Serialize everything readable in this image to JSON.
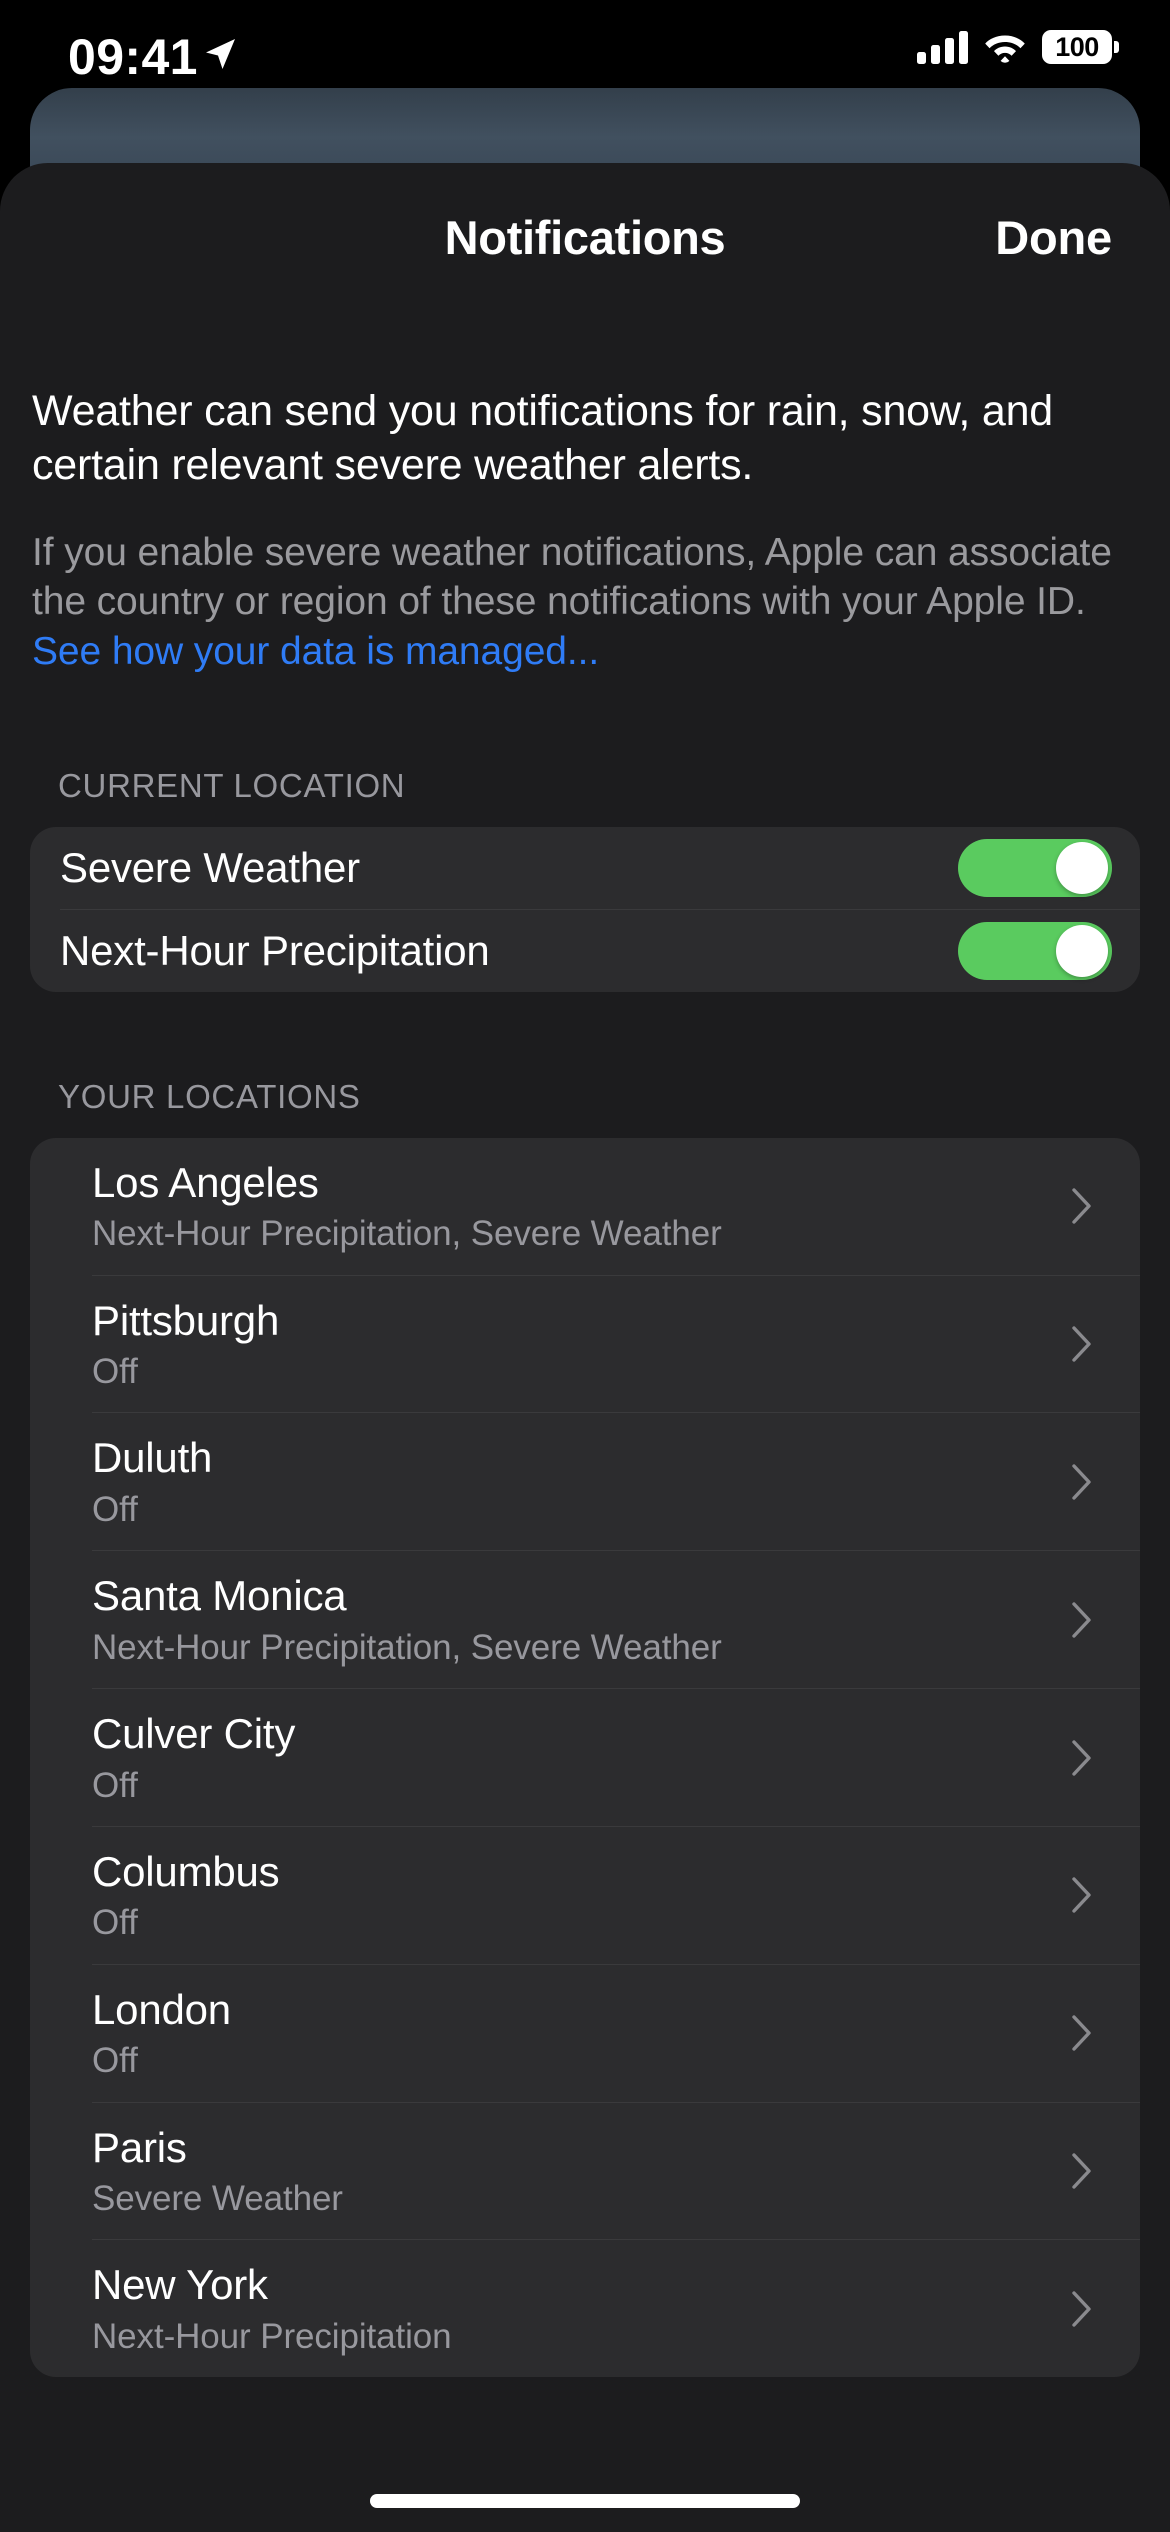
{
  "status_bar": {
    "time": "09:41",
    "location_arrow_icon": "location-arrow-icon",
    "cellular_icon": "cellular-signal-icon",
    "wifi_icon": "wifi-icon",
    "battery_level": "100"
  },
  "nav": {
    "title": "Notifications",
    "done_label": "Done"
  },
  "intro": {
    "primary": "Weather can send you notifications for rain, snow, and certain relevant severe weather alerts.",
    "secondary": "If you enable severe weather notifications, Apple can associate the country or region of these notifications with your Apple ID. ",
    "link_label": "See how your data is managed..."
  },
  "current_location": {
    "header": "CURRENT LOCATION",
    "rows": [
      {
        "label": "Severe Weather",
        "enabled": true
      },
      {
        "label": "Next-Hour Precipitation",
        "enabled": true
      }
    ]
  },
  "your_locations": {
    "header": "YOUR LOCATIONS",
    "rows": [
      {
        "name": "Los Angeles",
        "subtitle": "Next-Hour Precipitation, Severe Weather"
      },
      {
        "name": "Pittsburgh",
        "subtitle": "Off"
      },
      {
        "name": "Duluth",
        "subtitle": "Off"
      },
      {
        "name": "Santa Monica",
        "subtitle": "Next-Hour Precipitation, Severe Weather"
      },
      {
        "name": "Culver City",
        "subtitle": "Off"
      },
      {
        "name": "Columbus",
        "subtitle": "Off"
      },
      {
        "name": "London",
        "subtitle": "Off"
      },
      {
        "name": "Paris",
        "subtitle": "Severe Weather"
      },
      {
        "name": "New York",
        "subtitle": "Next-Hour Precipitation"
      }
    ]
  },
  "colors": {
    "sheet_background": "#1C1C1E",
    "card_background": "#2C2C2E",
    "toggle_on": "#5ACB5F",
    "link_blue": "#2F7CF6",
    "secondary_text": "#98989E",
    "separator": "#3A3A3C",
    "behind_card": "#41505F"
  }
}
